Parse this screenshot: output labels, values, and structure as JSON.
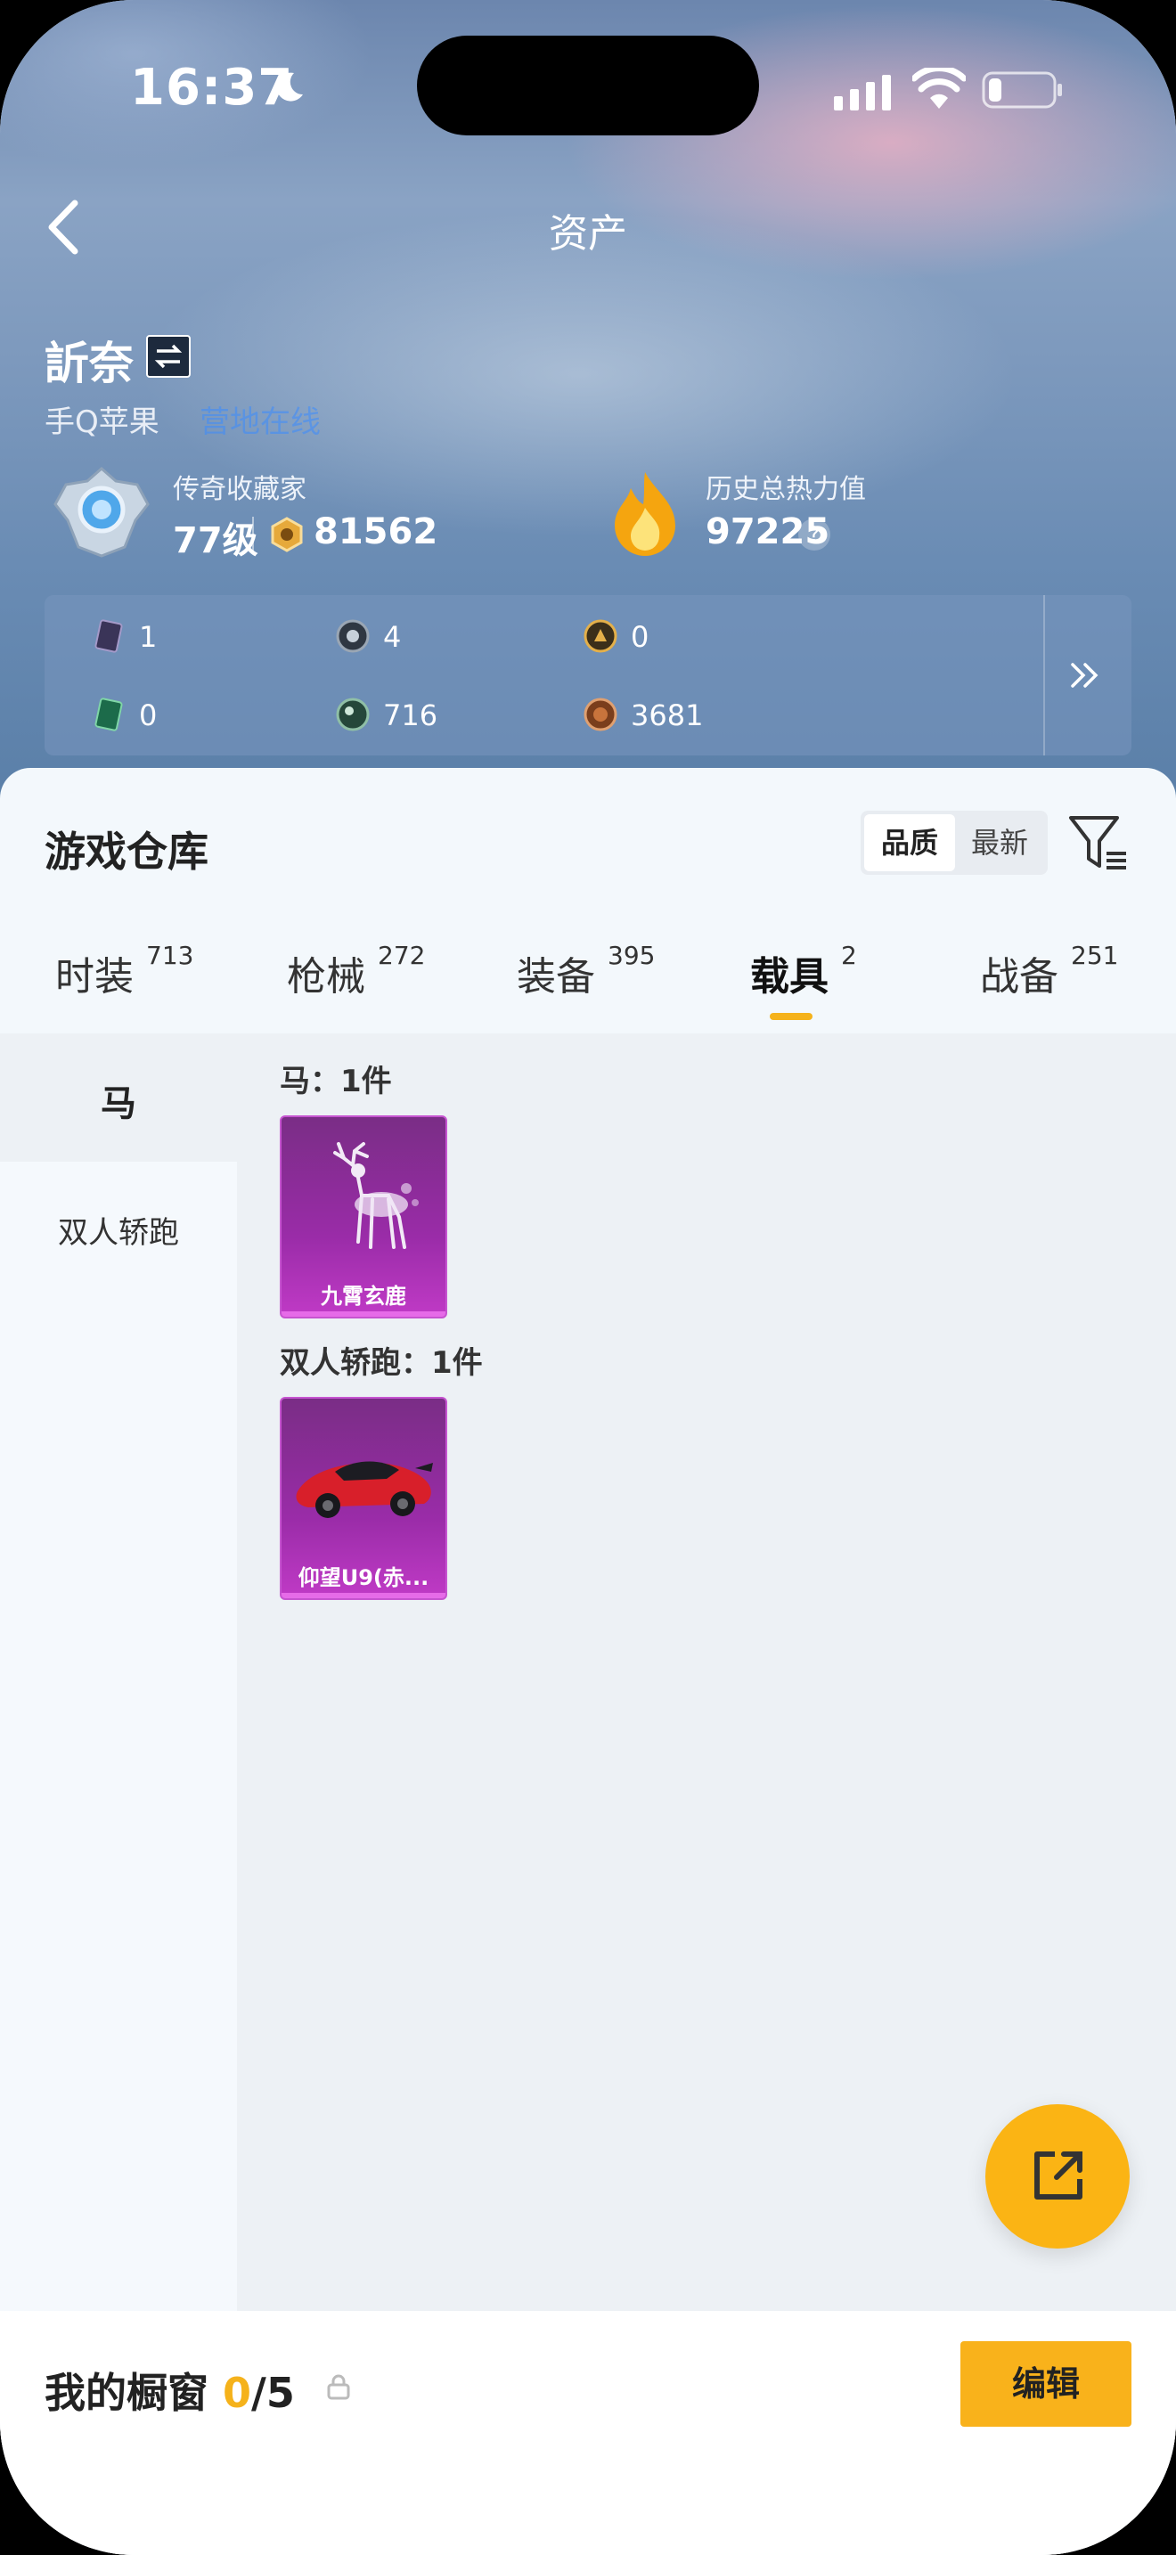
{
  "status": {
    "time": "16:37"
  },
  "header": {
    "title": "资产"
  },
  "profile": {
    "name": "訢奈",
    "platform": "手Q苹果",
    "platform_link": "营地在线",
    "rank_label": "传奇收藏家",
    "level": "77级",
    "points": "81562",
    "history_label": "历史总热力值",
    "history_value": "97225",
    "help": "?"
  },
  "stats": [
    {
      "icon": "card-icon",
      "value": "1"
    },
    {
      "icon": "badge-icon",
      "value": "4"
    },
    {
      "icon": "coin-icon",
      "value": "0"
    },
    {
      "icon": "green-card-icon",
      "value": "0"
    },
    {
      "icon": "orb-icon",
      "value": "716"
    },
    {
      "icon": "bronze-icon",
      "value": "3681"
    }
  ],
  "warehouse": {
    "title": "游戏仓库",
    "sort_options": [
      "品质",
      "最新"
    ],
    "tabs": [
      {
        "label": "时装",
        "count": "713"
      },
      {
        "label": "枪械",
        "count": "272"
      },
      {
        "label": "装备",
        "count": "395"
      },
      {
        "label": "载具",
        "count": "2"
      },
      {
        "label": "战备",
        "count": "251"
      }
    ],
    "active_tab": 3,
    "categories": [
      "马",
      "双人轿跑"
    ],
    "sections": [
      {
        "title": "马：1件",
        "items": [
          {
            "name": "九霄玄鹿"
          }
        ]
      },
      {
        "title": "双人轿跑：1件",
        "items": [
          {
            "name": "仰望U9(赤..."
          }
        ]
      }
    ],
    "rarity_color": "#9a2ca8"
  },
  "showcase": {
    "label": "我的橱窗",
    "count": "0",
    "total": "/5",
    "edit": "编辑"
  },
  "colors": {
    "accent": "#f5b21b",
    "link": "#3b8cff"
  }
}
